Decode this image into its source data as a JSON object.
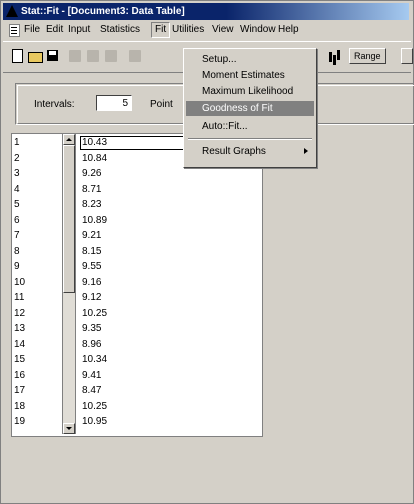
{
  "window": {
    "title": "Stat::Fit - [Document3: Data Table]"
  },
  "menubar": {
    "items": [
      {
        "label": "File"
      },
      {
        "label": "Edit"
      },
      {
        "label": "Input"
      },
      {
        "label": "Statistics"
      },
      {
        "label": "Fit"
      },
      {
        "label": "Utilities"
      },
      {
        "label": "View"
      },
      {
        "label": "Window"
      },
      {
        "label": "Help"
      }
    ]
  },
  "toolbar": {
    "range_label": "Range"
  },
  "panel": {
    "intervals_label": "Intervals:",
    "intervals_value": "5",
    "points_label": "Point"
  },
  "fit_menu": {
    "items": [
      {
        "label": "Setup..."
      },
      {
        "label": "Moment Estimates"
      },
      {
        "label": "Maximum Likelihood"
      },
      {
        "label": "Goodness of Fit"
      },
      {
        "label": "Auto::Fit..."
      },
      {
        "label": "Result Graphs"
      }
    ],
    "highlighted": "Goodness of Fit"
  },
  "table": {
    "rows": [
      {
        "n": "1",
        "v": "10.43"
      },
      {
        "n": "2",
        "v": "10.84"
      },
      {
        "n": "3",
        "v": "9.26"
      },
      {
        "n": "4",
        "v": "8.71"
      },
      {
        "n": "5",
        "v": "8.23"
      },
      {
        "n": "6",
        "v": "10.89"
      },
      {
        "n": "7",
        "v": "9.21"
      },
      {
        "n": "8",
        "v": "8.15"
      },
      {
        "n": "9",
        "v": "9.55"
      },
      {
        "n": "10",
        "v": "9.16"
      },
      {
        "n": "11",
        "v": "9.12"
      },
      {
        "n": "12",
        "v": "10.25"
      },
      {
        "n": "13",
        "v": "9.35"
      },
      {
        "n": "14",
        "v": "8.96"
      },
      {
        "n": "15",
        "v": "10.34"
      },
      {
        "n": "16",
        "v": "9.41"
      },
      {
        "n": "17",
        "v": "8.47"
      },
      {
        "n": "18",
        "v": "10.25"
      },
      {
        "n": "19",
        "v": "10.95"
      }
    ]
  },
  "colors": {
    "titlebar": "#0a246a",
    "menu_highlight": "#808080",
    "face": "#d4d0c8"
  }
}
